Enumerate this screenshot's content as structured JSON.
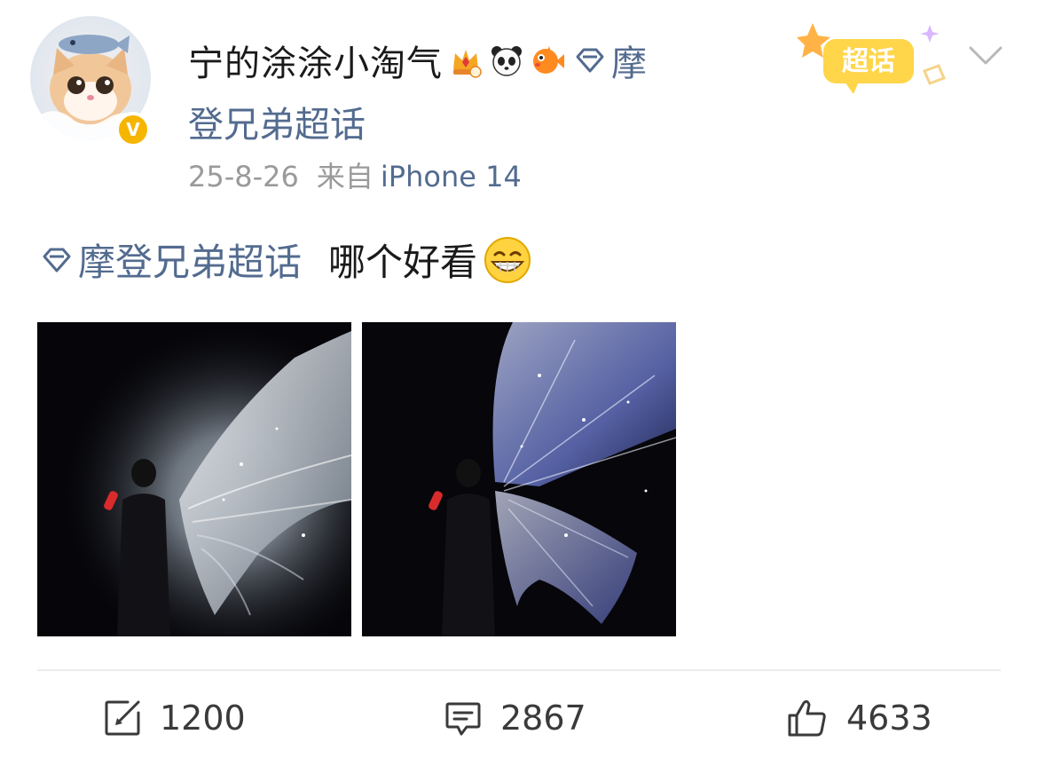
{
  "user": {
    "name": "宁的涂涂小淘气",
    "badges": [
      "crown-badge-icon",
      "panda-badge-icon",
      "pufferfish-badge-icon"
    ],
    "verified_mark": "V",
    "supertopic_line1": "摩",
    "supertopic_line2": "登兄弟超话"
  },
  "post_meta": {
    "date": "25-8-26",
    "source_prefix": "来自",
    "device": "iPhone 14"
  },
  "chaohua_tag": {
    "label": "超话"
  },
  "post": {
    "topic": "摩登兄弟超话",
    "text": "哪个好看",
    "emoji": "grin-emoji",
    "images": [
      {
        "name": "angel-wings-photo"
      },
      {
        "name": "butterfly-wings-photo"
      }
    ]
  },
  "actions": {
    "repost_count": "1200",
    "comment_count": "2867",
    "like_count": "4633"
  },
  "colors": {
    "link": "#536b8f",
    "meta": "#9a9a9a",
    "text": "#1a1a1a",
    "verified": "#f6b500"
  }
}
